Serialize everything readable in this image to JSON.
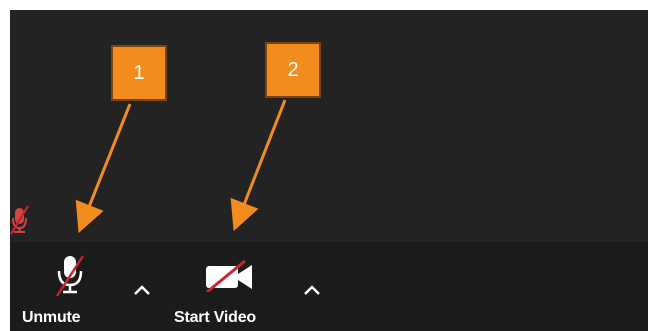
{
  "toolbar": {
    "unmute_label": "Unmute",
    "start_video_label": "Start Video"
  },
  "icons": {
    "muted_indicator": "mic-muted-icon",
    "microphone": "mic-off-icon",
    "video": "video-off-icon",
    "caret": "chevron-up-icon"
  },
  "annotations": {
    "box1": "1",
    "box2": "2"
  },
  "colors": {
    "annotation_fill": "#f28c1f",
    "annotation_border": "#7a4410",
    "arrow": "#f28c1f",
    "slash": "#c1272d",
    "background": "#222222",
    "toolbar": "#1b1b1b"
  }
}
